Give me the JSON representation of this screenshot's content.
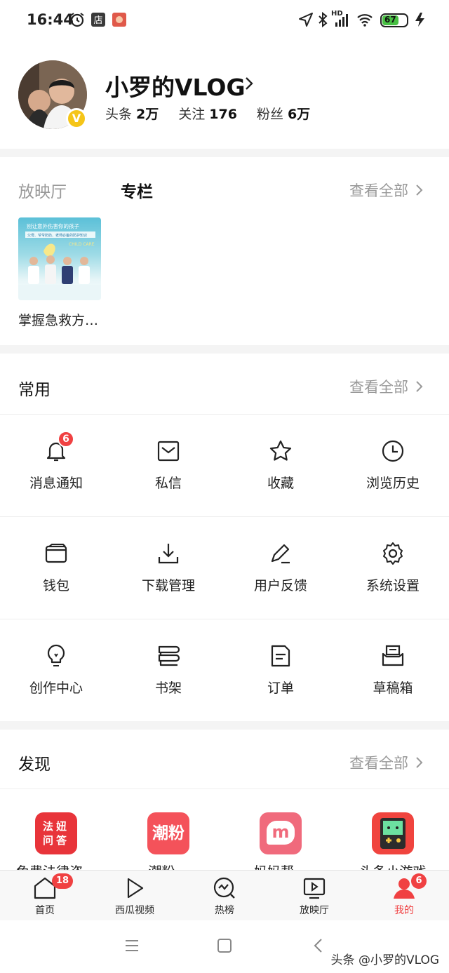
{
  "status_bar": {
    "time": "16:44",
    "left_icons": [
      "alarm-icon",
      "store-icon",
      "app-icon"
    ],
    "right_icons": [
      "location-icon",
      "bluetooth-icon",
      "signal-icon",
      "wifi-icon",
      "battery-icon",
      "charging-icon"
    ],
    "network_label": "HD",
    "battery_level": "67"
  },
  "profile": {
    "username": "小罗的VLOG",
    "verified_badge": "V",
    "stats": [
      {
        "label": "头条",
        "value": "2万"
      },
      {
        "label": "关注",
        "value": "176"
      },
      {
        "label": "粉丝",
        "value": "6万"
      }
    ]
  },
  "media_section": {
    "tabs": [
      {
        "label": "放映厅",
        "active": false
      },
      {
        "label": "专栏",
        "active": true
      }
    ],
    "see_all": "查看全部",
    "items": [
      {
        "caption": "掌握急救方…",
        "thumb_title": "别让意外伤害你的孩子",
        "thumb_subtitle": "父母、爷爷奶奶、老师必备的防护知识",
        "thumb_tag": "CHILD CARE"
      }
    ]
  },
  "common_section": {
    "title": "常用",
    "see_all": "查看全部",
    "items": [
      {
        "label": "消息通知",
        "icon": "bell-icon",
        "badge": "6"
      },
      {
        "label": "私信",
        "icon": "mail-icon"
      },
      {
        "label": "收藏",
        "icon": "star-icon"
      },
      {
        "label": "浏览历史",
        "icon": "clock-icon"
      },
      {
        "label": "钱包",
        "icon": "wallet-icon"
      },
      {
        "label": "下载管理",
        "icon": "download-icon"
      },
      {
        "label": "用户反馈",
        "icon": "pen-icon"
      },
      {
        "label": "系统设置",
        "icon": "gear-icon"
      },
      {
        "label": "创作中心",
        "icon": "lightbulb-icon"
      },
      {
        "label": "书架",
        "icon": "bookshelf-icon"
      },
      {
        "label": "订单",
        "icon": "document-icon"
      },
      {
        "label": "草稿箱",
        "icon": "drafts-icon"
      }
    ]
  },
  "discover_section": {
    "title": "发现",
    "see_all": "查看全部",
    "items": [
      {
        "label": "免费法律咨…",
        "icon_text": "法妞问答",
        "color": "#e8343a"
      },
      {
        "label": "潮粉…",
        "icon_text": "潮粉",
        "color": "#f4525a"
      },
      {
        "label": "妈妈帮…",
        "icon_text": "m",
        "color": "#f06a7c"
      },
      {
        "label": "头条小游戏",
        "icon_text": "",
        "color": "#f0443e"
      }
    ]
  },
  "tab_bar": {
    "tabs": [
      {
        "label": "首页",
        "icon": "home-icon",
        "badge": "18",
        "active": false
      },
      {
        "label": "西瓜视频",
        "icon": "play-icon",
        "active": false
      },
      {
        "label": "热榜",
        "icon": "trending-icon",
        "active": false
      },
      {
        "label": "放映厅",
        "icon": "tv-icon",
        "active": false
      },
      {
        "label": "我的",
        "icon": "profile-icon",
        "badge": "6",
        "active": true
      }
    ],
    "active_color": "#f04142"
  },
  "nav_bar": {
    "buttons": [
      "menu-icon",
      "home-square-icon",
      "back-icon"
    ],
    "watermark": "头条 @小罗的VLOG"
  }
}
